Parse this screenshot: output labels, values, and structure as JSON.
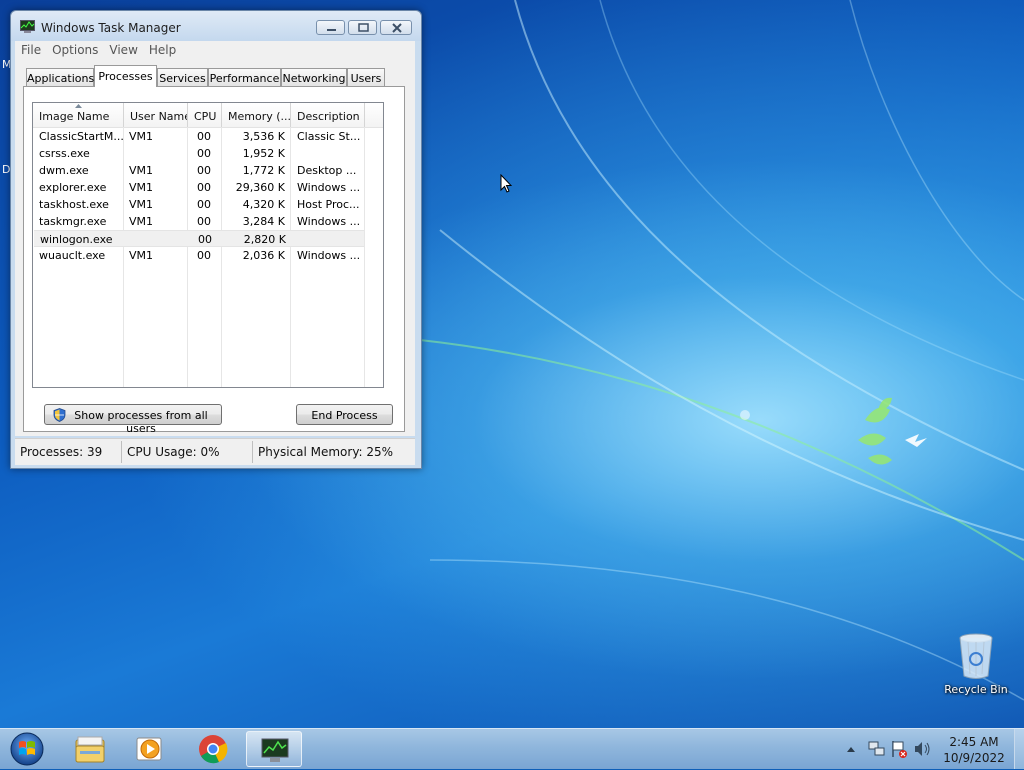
{
  "desktop": {
    "edge_letters": [
      "M",
      "D"
    ],
    "icons": [
      {
        "label": "Recycle Bin",
        "icon": "recycle-bin-icon"
      }
    ]
  },
  "taskmgr": {
    "title": "Windows Task Manager",
    "menu": [
      "File",
      "Options",
      "View",
      "Help"
    ],
    "tabs": [
      "Applications",
      "Processes",
      "Services",
      "Performance",
      "Networking",
      "Users"
    ],
    "active_tab": "Processes",
    "columns": [
      "Image Name",
      "User Name",
      "CPU",
      "Memory (...",
      "Description"
    ],
    "processes": [
      {
        "name": "ClassicStartM...",
        "user": "VM1",
        "cpu": "00",
        "mem": "3,536 K",
        "desc": "Classic St..."
      },
      {
        "name": "csrss.exe",
        "user": "",
        "cpu": "00",
        "mem": "1,952 K",
        "desc": ""
      },
      {
        "name": "dwm.exe",
        "user": "VM1",
        "cpu": "00",
        "mem": "1,772 K",
        "desc": "Desktop ..."
      },
      {
        "name": "explorer.exe",
        "user": "VM1",
        "cpu": "00",
        "mem": "29,360 K",
        "desc": "Windows ..."
      },
      {
        "name": "taskhost.exe",
        "user": "VM1",
        "cpu": "00",
        "mem": "4,320 K",
        "desc": "Host Proc..."
      },
      {
        "name": "taskmgr.exe",
        "user": "VM1",
        "cpu": "00",
        "mem": "3,284 K",
        "desc": "Windows ..."
      },
      {
        "name": "winlogon.exe",
        "user": "",
        "cpu": "00",
        "mem": "2,820 K",
        "desc": ""
      },
      {
        "name": "wuauclt.exe",
        "user": "VM1",
        "cpu": "00",
        "mem": "2,036 K",
        "desc": "Windows ..."
      }
    ],
    "selected_row": 6,
    "show_all_label": "Show processes from all users",
    "end_process_label": "End Process",
    "status": {
      "processes": "Processes: 39",
      "cpu": "CPU Usage: 0%",
      "memory": "Physical Memory: 25%"
    }
  },
  "taskbar": {
    "pinned": [
      "windows-explorer-icon",
      "media-player-icon",
      "chrome-icon",
      "task-manager-icon"
    ],
    "active_item": "task-manager-icon",
    "tray_icons": [
      "show-hidden-icons-arrow",
      "network-icon",
      "action-center-flag-icon",
      "volume-icon"
    ],
    "clock_time": "2:45 AM",
    "clock_date": "10/9/2022"
  }
}
